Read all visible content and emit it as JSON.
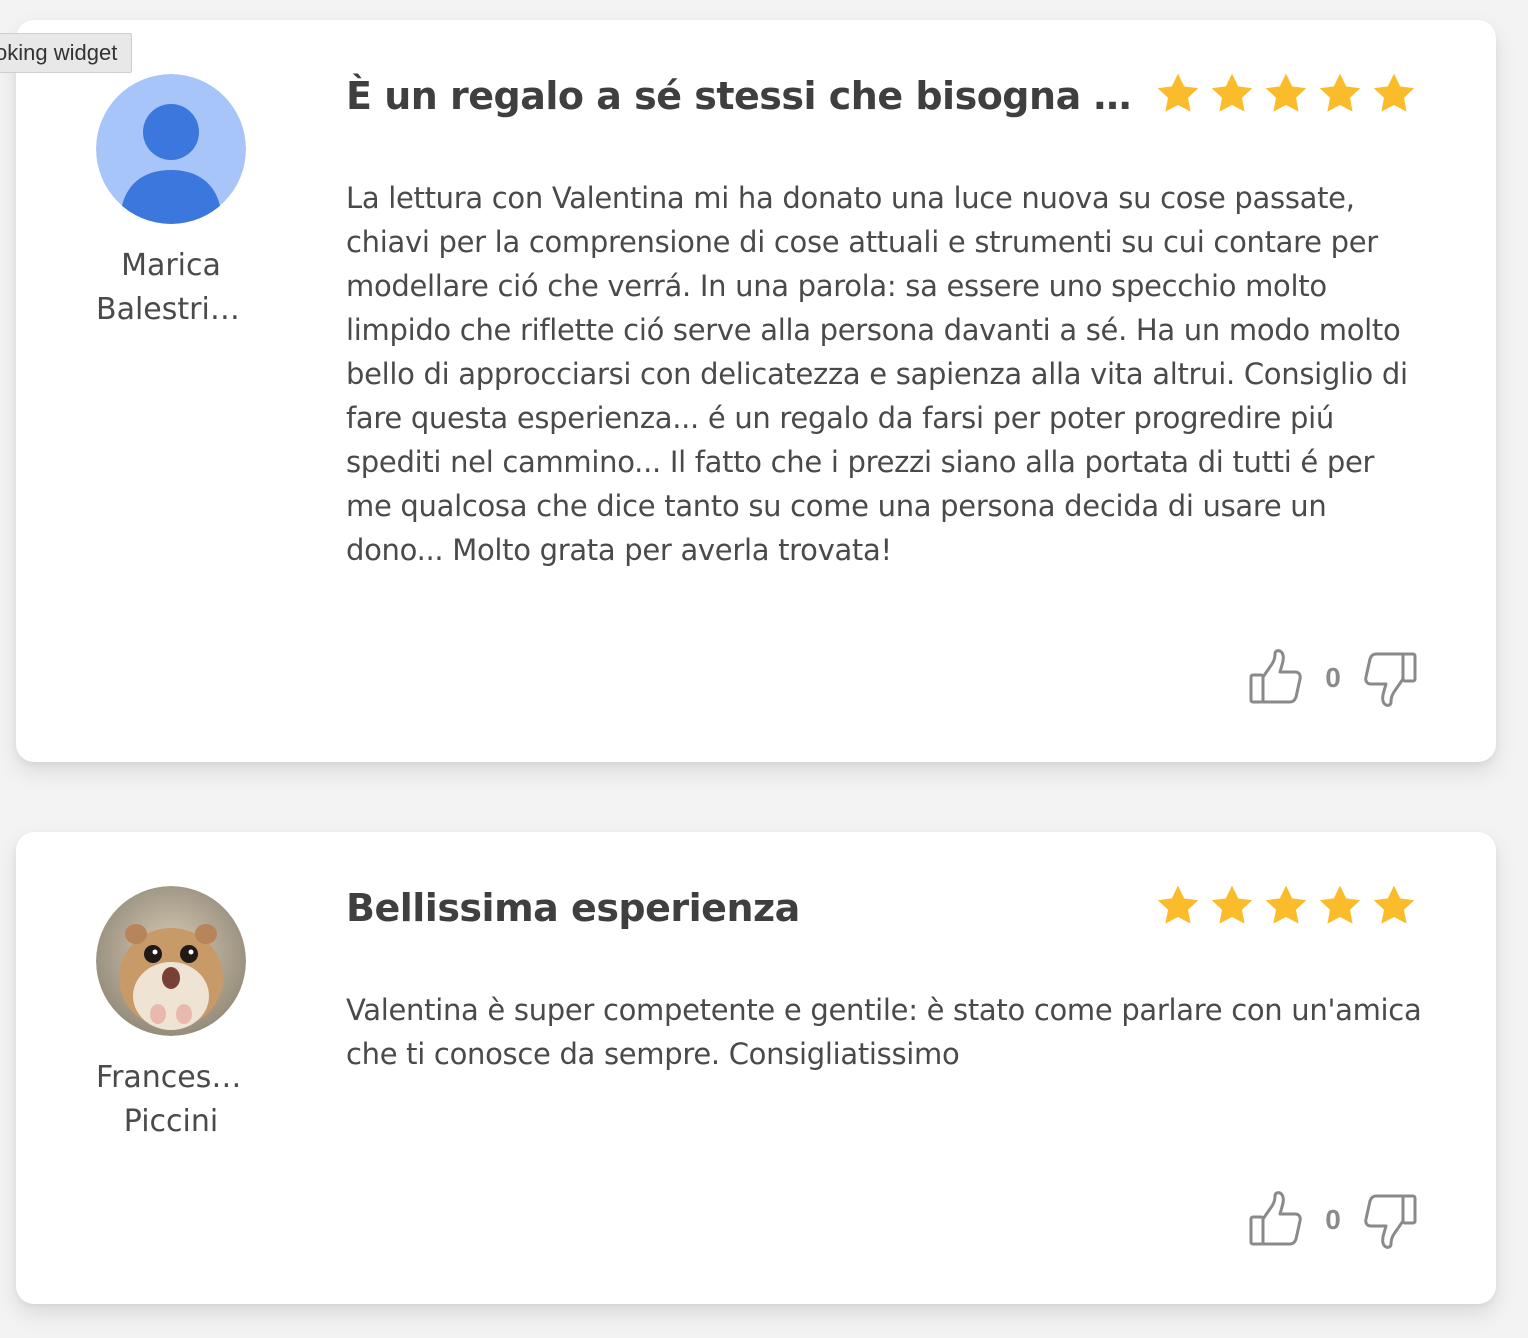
{
  "tooltip": {
    "text": "oking widget"
  },
  "reviews": [
    {
      "author_first": "Marica",
      "author_last": "Balestrieri",
      "avatar": "default-person-icon",
      "title": "È un regalo a sé stessi che bisogna farsi...",
      "rating": 5,
      "body": "La lettura con Valentina mi ha donato una luce nuova su cose passate, chiavi per la comprensione di cose attuali e strumenti su cui contare per modellare ció che verrá. In una parola: sa essere uno specchio molto limpido che riflette ció serve alla persona davanti a sé. Ha un modo molto bello di approcciarsi con delicatezza e sapienza alla vita altrui. Consiglio di fare questa esperienza... é un regalo da farsi per poter progredire piú spediti nel cammino... Il fatto che i prezzi siano alla portata di tutti é per me qualcosa che dice tanto su come una persona decida di usare un dono... Molto grata per averla trovata!",
      "votes": "0"
    },
    {
      "author_first": "Francesc...",
      "author_last": "Piccini",
      "avatar": "hamster-photo",
      "title": "Bellissima esperienza",
      "rating": 5,
      "body": "Valentina è super competente e gentile: è stato come parlare con un'amica che ti conosce da sempre. Consigliatissimo",
      "votes": "0"
    }
  ],
  "colors": {
    "star": "#fbbc2c",
    "card_bg": "#ffffff",
    "page_bg": "#f3f3f3",
    "avatar_bg": "#a7c5f9",
    "avatar_fg": "#3b77dc"
  }
}
